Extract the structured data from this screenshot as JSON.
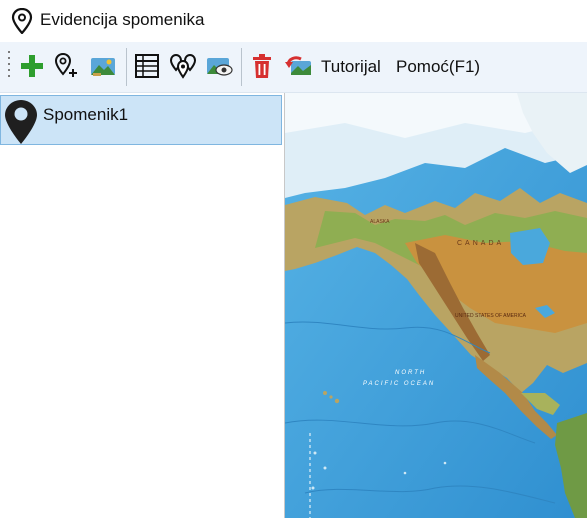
{
  "window": {
    "title": "Evidencija spomenika",
    "title_icon": "location-pin-icon"
  },
  "toolbar": {
    "buttons": [
      {
        "name": "add-button",
        "icon": "plus-icon"
      },
      {
        "name": "add-location-button",
        "icon": "location-pin-plus-icon"
      },
      {
        "name": "map-image-button",
        "icon": "landscape-image-icon"
      },
      {
        "name": "table-view-button",
        "icon": "table-icon"
      },
      {
        "name": "multi-location-button",
        "icon": "multi-pin-icon"
      },
      {
        "name": "view-image-button",
        "icon": "image-eye-icon"
      },
      {
        "name": "delete-button",
        "icon": "trash-icon"
      },
      {
        "name": "undo-button",
        "icon": "undo-arrow-icon"
      }
    ],
    "tutorial_label": "Tutorijal",
    "help_label": "Pomoć(F1)"
  },
  "list": {
    "items": [
      {
        "label": "Spomenik1",
        "icon": "location-pin-icon"
      }
    ]
  },
  "map": {
    "labels": {
      "canada": "CANADA",
      "north_pacific": "NORTH",
      "pacific_ocean": "PACIFIC OCEAN",
      "united_states": "UNITED STATES OF AMERICA",
      "alaska": "ALASKA"
    }
  },
  "colors": {
    "toolbar_bg": "#eef4fb",
    "selection_bg": "#cce4f7",
    "selection_border": "#7fb6e0",
    "accent_green": "#2e9e2e",
    "accent_red": "#d63030",
    "ocean": "#3f9fd6"
  }
}
